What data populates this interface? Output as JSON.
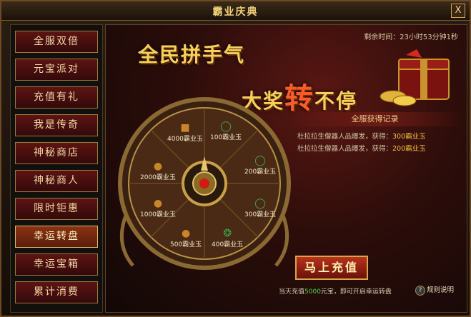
{
  "window": {
    "title": "霸业庆典",
    "close_label": "X"
  },
  "sidebar": {
    "items": [
      {
        "label": "全服双倍"
      },
      {
        "label": "元宝派对"
      },
      {
        "label": "充值有礼"
      },
      {
        "label": "我是传奇"
      },
      {
        "label": "神秘商店"
      },
      {
        "label": "神秘商人"
      },
      {
        "label": "限时钜惠"
      },
      {
        "label": "幸运转盘"
      },
      {
        "label": "幸运宝箱"
      },
      {
        "label": "累计消费"
      }
    ],
    "active_index": 7
  },
  "main": {
    "timer": "剩余时间：23小时53分钟1秒",
    "slogan_line1": "全民拼手气",
    "slogan_line2_a": "大奖",
    "slogan_line2_b": "转",
    "slogan_line2_c": "不停",
    "records": {
      "header": "全服获得记录",
      "entries": [
        {
          "text": "杜拉拉生僧器人品爆发，获得：",
          "prize": "300霸业玉"
        },
        {
          "text": "杜拉拉生僧器人品爆发，获得：",
          "prize": "200霸业玉"
        }
      ]
    },
    "wheel": {
      "prizes": [
        {
          "label": "100霸业玉"
        },
        {
          "label": "200霸业玉"
        },
        {
          "label": "300霸业玉"
        },
        {
          "label": "400霸业玉"
        },
        {
          "label": "500霸业玉"
        },
        {
          "label": "1000霸业玉"
        },
        {
          "label": "2000霸业玉"
        },
        {
          "label": "4000霸业玉"
        }
      ]
    },
    "recharge_button": "马上充值",
    "note_prefix": "当天充值",
    "note_amount": "5000",
    "note_suffix": "元宝，即可开启幸运转盘",
    "rules_label": "规则说明"
  },
  "colors": {
    "gold": "#f6d05a",
    "accent_red": "#6a120a",
    "green": "#5ad14e"
  }
}
